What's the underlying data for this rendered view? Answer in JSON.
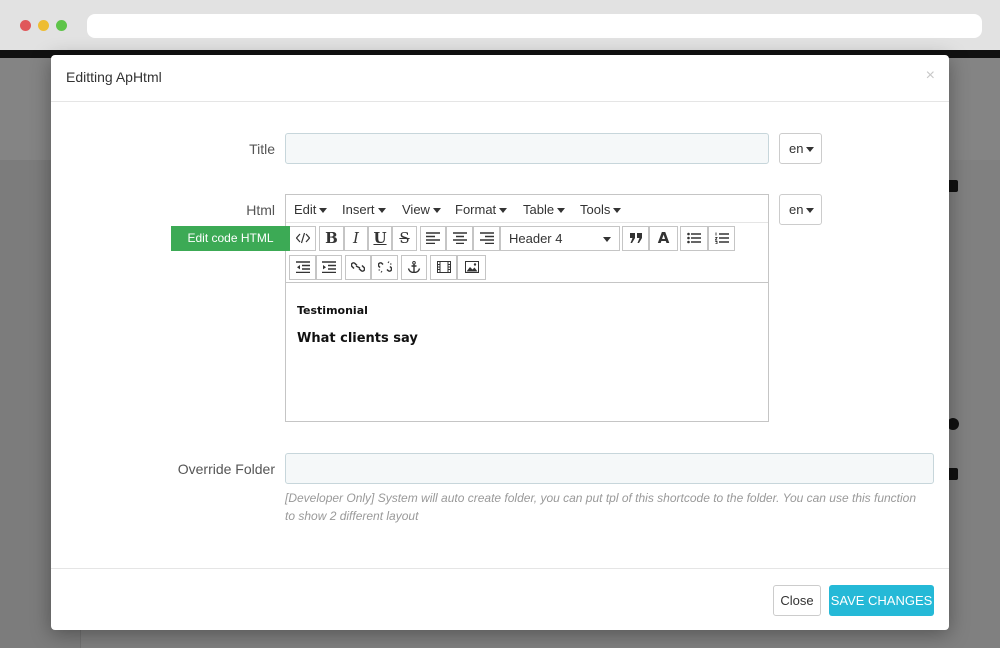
{
  "modal": {
    "title": "Editting ApHtml",
    "close_glyph": "×"
  },
  "form": {
    "title_label": "Title",
    "title_value": "",
    "html_label": "Html",
    "override_label": "Override Folder",
    "override_value": "",
    "override_help": "[Developer Only] System will auto create folder, you can put tpl of this shortcode to the folder. You can use this function to show 2 different layout",
    "lang_title": "en",
    "lang_html": "en"
  },
  "editor": {
    "menus": [
      "Edit",
      "Insert",
      "View",
      "Format",
      "Table",
      "Tools"
    ],
    "edit_code_label": "Edit code HTML",
    "format_select": "Header 4",
    "content": {
      "heading_small": "Testimonial",
      "heading_large": "What clients say"
    },
    "toolbar_icons": [
      "code-icon",
      "bold-icon",
      "italic-icon",
      "underline-icon",
      "strikethrough-icon",
      "align-left-icon",
      "align-center-icon",
      "align-right-icon",
      "format-select",
      "blockquote-icon",
      "text-color-icon",
      "bullet-list-icon",
      "numbered-list-icon",
      "outdent-icon",
      "indent-icon",
      "link-icon",
      "unlink-icon",
      "anchor-icon",
      "media-icon",
      "image-icon"
    ]
  },
  "footer": {
    "close_label": "Close",
    "save_label": "SAVE CHANGES"
  },
  "colors": {
    "save_button": "#25b9d7",
    "edit_code_button": "#3caa55"
  }
}
